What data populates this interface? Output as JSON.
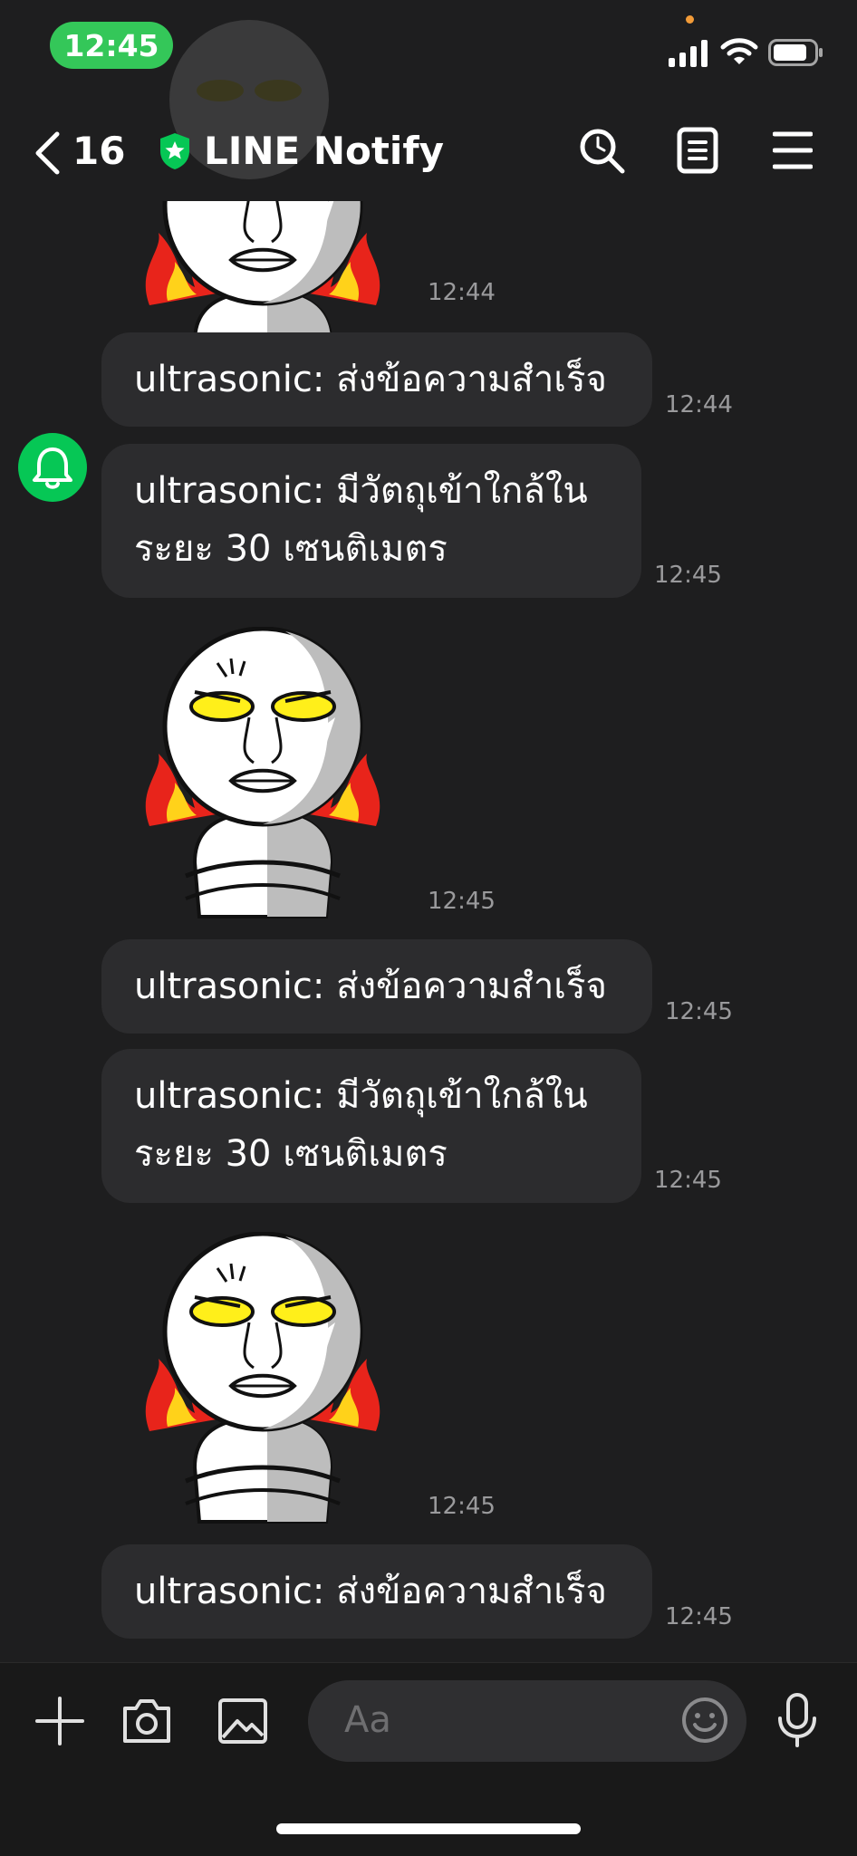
{
  "status": {
    "time": "12:45"
  },
  "header": {
    "back_count": "16",
    "title": "LINE Notify"
  },
  "messages": [
    {
      "type": "sticker",
      "time": "12:44"
    },
    {
      "type": "text",
      "lines": [
        "ultrasonic: ส่งข้อความสำเร็จ"
      ],
      "time": "12:44"
    },
    {
      "type": "text",
      "lines": [
        "ultrasonic: มีวัตถุเข้าใกล้ใน",
        "ระยะ 30 เซนติเมตร"
      ],
      "time": "12:45"
    },
    {
      "type": "sticker",
      "time": "12:45"
    },
    {
      "type": "text",
      "lines": [
        "ultrasonic: ส่งข้อความสำเร็จ"
      ],
      "time": "12:45"
    },
    {
      "type": "text",
      "lines": [
        "ultrasonic: มีวัตถุเข้าใกล้ใน",
        "ระยะ 30 เซนติเมตร"
      ],
      "time": "12:45"
    },
    {
      "type": "sticker",
      "time": "12:45"
    },
    {
      "type": "text",
      "lines": [
        "ultrasonic: ส่งข้อความสำเร็จ"
      ],
      "time": "12:45"
    }
  ],
  "composer": {
    "placeholder": "Aa"
  },
  "colors": {
    "accent_green": "#06c755",
    "status_green": "#34c759",
    "bubble": "#2c2c2e",
    "background": "#1e1e1f"
  },
  "icons": [
    "back-icon",
    "shield-star-icon",
    "search-icon",
    "notes-icon",
    "menu-icon",
    "bell-icon",
    "plus-icon",
    "camera-icon",
    "image-icon",
    "emoji-icon",
    "microphone-icon",
    "signal-icon",
    "wifi-icon",
    "battery-icon"
  ]
}
